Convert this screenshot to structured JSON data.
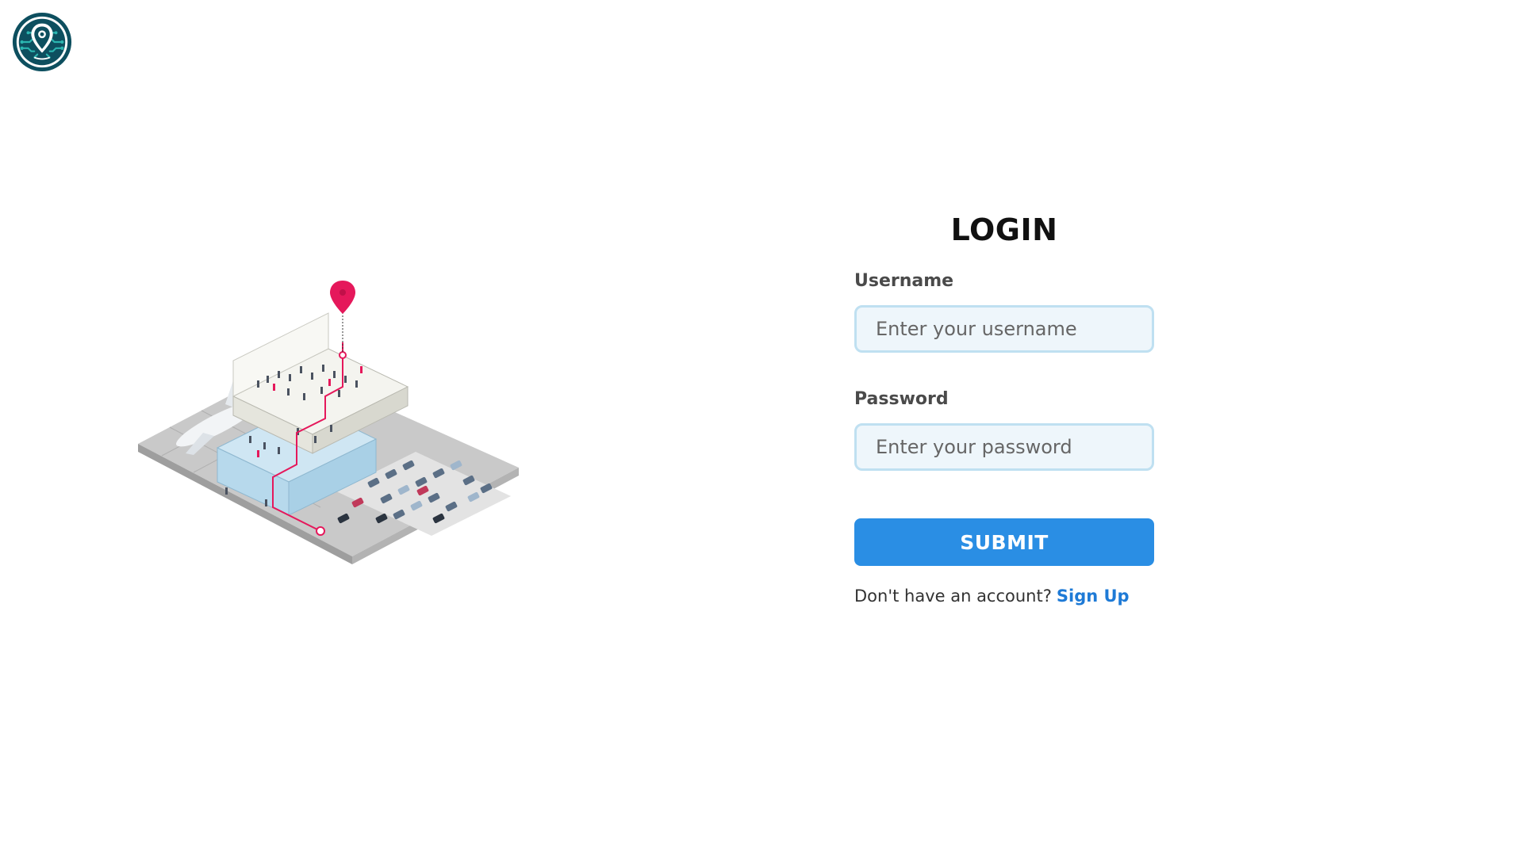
{
  "brand": {
    "logo_icon": "map-pin-circuit-icon",
    "primary_color": "#0d4f5f",
    "accent_color": "#2bb5b0"
  },
  "illustration": {
    "icon": "airport-isometric-illustration",
    "pin_color": "#e5185b"
  },
  "login": {
    "title": "LOGIN",
    "username_label": "Username",
    "username_placeholder": "Enter your username",
    "password_label": "Password",
    "password_placeholder": "Enter your password",
    "submit_label": "SUBMIT",
    "submit_color": "#2a8ee4",
    "signup_prompt": "Don't have an account?",
    "signup_link": "Sign Up",
    "link_color": "#1e7ad6"
  }
}
